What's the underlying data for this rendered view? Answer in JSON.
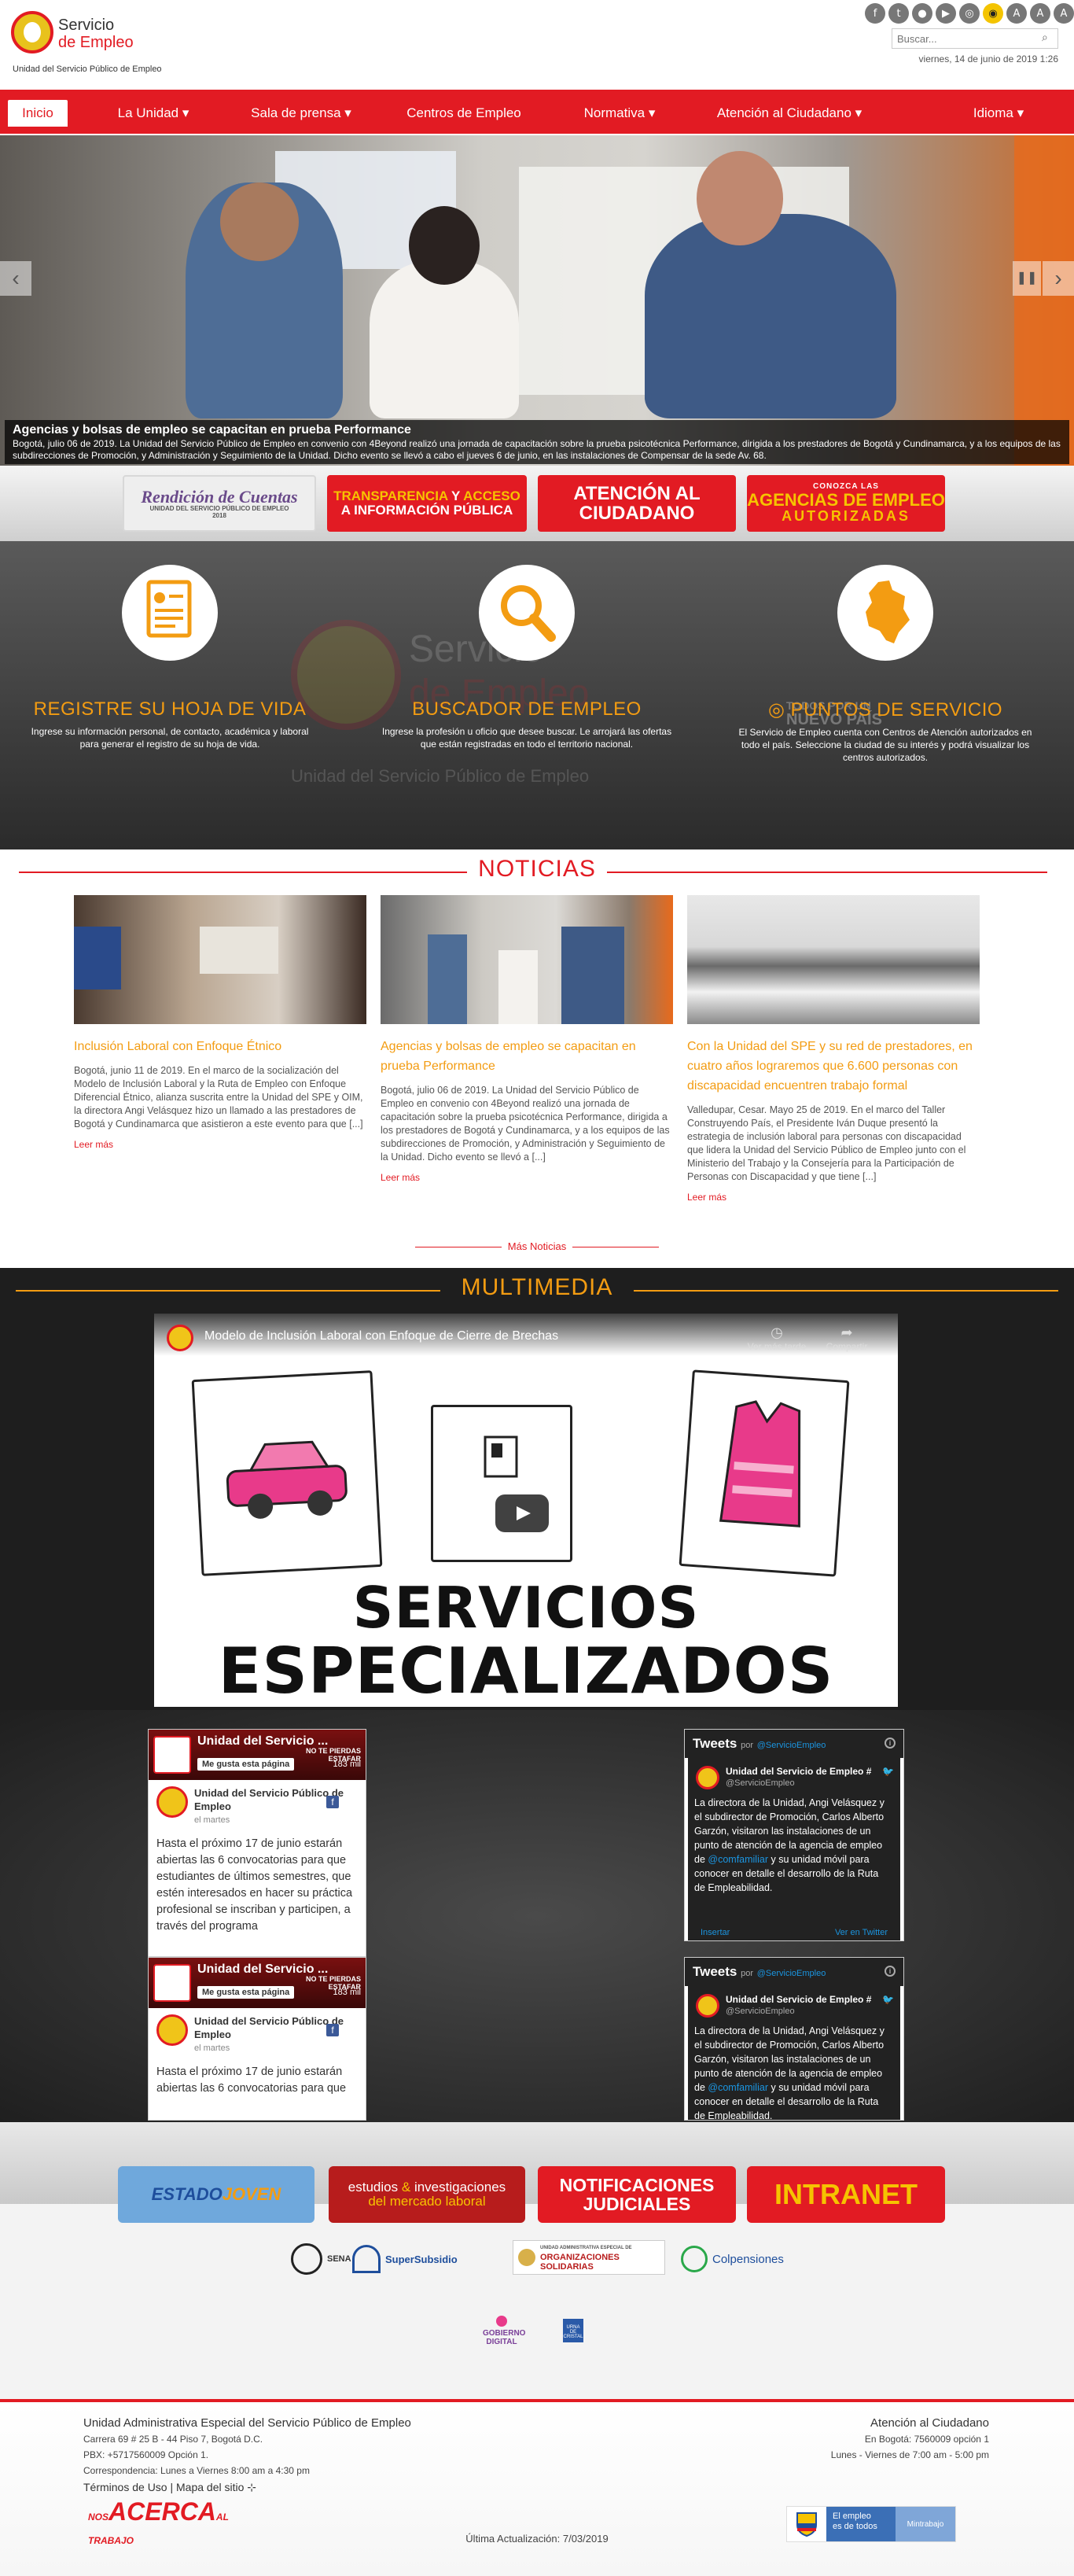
{
  "header": {
    "logo_line1": "Servicio",
    "logo_line2": "de Empleo",
    "logo_sub": "Unidad del Servicio Público de Empleo",
    "social_icons": [
      "facebook-icon",
      "twitter-icon",
      "flickr-icon",
      "youtube-icon",
      "instagram-icon",
      "visibility-icon",
      "font-size-icon",
      "font-size-larger-icon",
      "font-size-largest-icon"
    ],
    "search_placeholder": "Buscar...",
    "date": "viernes, 14 de junio de 2019 1:26"
  },
  "nav": {
    "items": [
      "Inicio",
      "La Unidad",
      "Sala de prensa",
      "Centros de Empleo",
      "Normativa",
      "Atención al Ciudadano",
      "Idioma"
    ],
    "active": "Inicio",
    "accent": "#e21b23"
  },
  "hero": {
    "title": "Agencias y bolsas de empleo se capacitan en prueba Performance",
    "text": "Bogotá, julio 06 de 2019. La Unidad del Servicio Público de Empleo en convenio con 4Beyond realizó una jornada de capacitación sobre la prueba psicotécnica Performance, dirigida a los prestadores de Bogotá y Cundinamarca, y a los equipos de las subdirecciones de Promoción, y Administración y Seguimiento de la Unidad. Dicho evento se llevó a cabo el jueves 6 de junio, en las instalaciones de Compensar de la sede Av. 68."
  },
  "banners": {
    "rendicion": "Rendición de Cuentas",
    "rendicion_sub": "UNIDAD DEL SERVICIO PÚBLICO DE EMPLEO",
    "rendicion_year": "2018",
    "transparencia_a": "TRANSPARENCIA",
    "transparencia_y": "Y",
    "transparencia_b": "ACCESO",
    "transparencia_c": "A INFORMACIÓN PÚBLICA",
    "atencion_a": "ATENCIÓN AL",
    "atencion_b": "CIUDADANO",
    "agencias_pre": "CONOZCA LAS",
    "agencias_a": "AGENCIAS DE EMPLEO",
    "agencias_b": "AUTORIZADAS"
  },
  "services": [
    {
      "title": "REGISTRE SU HOJA DE VIDA",
      "text": "Ingrese su información personal, de contacto, académica y laboral para generar el registro de su hoja de vida.",
      "icon": "resume-document-icon"
    },
    {
      "title": "BUSCADOR DE EMPLEO",
      "text": "Ingrese la profesión u oficio que desee buscar. Le arrojará las ofertas que están registradas en todo el territorio nacional.",
      "icon": "magnifier-search-icon"
    },
    {
      "title": "PUNTOS DE SERVICIO",
      "text": "El Servicio de Empleo cuenta con Centros de Atención autorizados en todo el país. Seleccione la ciudad de su interés y podrá visualizar los centros autorizados.",
      "icon": "colombia-map-icon"
    }
  ],
  "services_watermark": {
    "logo_a": "Servicio",
    "logo_b": "de Empleo",
    "caption": "Unidad del Servicio Público de Empleo",
    "slogan_a": "TODOS POR UN",
    "slogan_b": "NUEVO PAÍS"
  },
  "noticias": {
    "title": "NOTICIAS",
    "items": [
      {
        "title": "Inclusión Laboral con Enfoque Étnico",
        "text": "Bogotá, junio 11 de 2019. En el marco de la socialización del Modelo de Inclusión Laboral y la Ruta de Empleo con Enfoque Diferencial Étnico, alianza suscrita entre la Unidad del SPE y OIM, la directora Angi Velásquez hizo un llamado a las prestadores de Bogotá y Cundinamarca que asistieron a este evento para que [...]",
        "more": "Leer más"
      },
      {
        "title": "Agencias y bolsas de empleo se capacitan en prueba Performance",
        "text": "Bogotá, julio 06 de 2019. La Unidad del Servicio Público de Empleo en convenio con 4Beyond realizó una jornada de capacitación sobre la prueba psicotécnica Performance, dirigida a los prestadores de Bogotá y Cundinamarca, y a los equipos de las subdirecciones de Promoción, y Administración y Seguimiento de la Unidad. Dicho evento se llevó a [...]",
        "more": "Leer más"
      },
      {
        "title": "Con la Unidad del SPE y su red de prestadores, en cuatro años lograremos que 6.600 personas con discapacidad encuentren trabajo formal",
        "text": "Valledupar, Cesar. Mayo 25 de 2019. En el marco del Taller Construyendo País, el Presidente Iván Duque presentó la estrategia de inclusión laboral para personas con discapacidad que lidera la Unidad del Servicio Público de Empleo junto con el Ministerio del Trabajo y la Consejería para la Participación de Personas con Discapacidad y que tiene [...]",
        "more": "Leer más"
      }
    ],
    "more_link": "Más Noticias"
  },
  "multimedia": {
    "title": "MULTIMEDIA",
    "video_title": "Modelo de Inclusión Laboral con Enfoque de Cierre de Brechas",
    "watch_later": "Ver más tarde",
    "share": "Compartir",
    "line1": "SERVICIOS",
    "line2": "ESPECIALIZADOS"
  },
  "facebook": {
    "page_name": "Unidad del Servicio ...",
    "like": "Me gusta esta página",
    "count": "183 mil",
    "badge_a": "NO TE PIERDAS",
    "badge_b": "ESTAFAR",
    "post_name": "Unidad del Servicio Público de Empleo",
    "post_date": "el martes",
    "post_text_long": "Hasta el próximo 17 de junio estarán abiertas las 6 convocatorias para que estudiantes de últimos semestres, que estén interesados en hacer su práctica profesional se inscriban y participen, a través del programa",
    "post_text_short": "Hasta el próximo 17 de junio estarán abiertas las 6 convocatorias para que"
  },
  "twitter": {
    "title": "Tweets",
    "by": "por",
    "handle": "@ServicioEmpleo",
    "author": "Unidad del Servicio de Empleo #",
    "text_a": "La directora de la Unidad, Angi Velásquez y el subdirector de Promoción, Carlos Alberto Garzón, visitaron las instalaciones de un punto de atención de la agencia de empleo de",
    "mention": "@comfamiliar",
    "text_b": "y su unidad móvil para conocer en detalle el desarrollo de la Ruta de Empleabilidad.",
    "insert": "Insertar",
    "view": "Ver en Twitter"
  },
  "lower_banners": {
    "estado": "ESTADO",
    "joven": "JOVEN",
    "estudios_a": "estudios",
    "estudios_amp": "&",
    "estudios_b": "investigaciones",
    "estudios_c": "del mercado laboral",
    "notif_a": "NOTIFICACIONES",
    "notif_b": "JUDICIALES",
    "intra_a": "INTRA",
    "intra_b": "NET"
  },
  "partners": {
    "sena": "SENA",
    "supersubsidio": "SuperSubsidio",
    "org_pre": "UNIDAD ADMINISTRATIVA ESPECIAL DE",
    "org_a": "ORGANIZACIONES",
    "org_b": "SOLIDARIAS",
    "colpensiones": "Colpensiones",
    "gobierno_a": "GOBIERNO",
    "gobierno_b": "DIGITAL",
    "urna": "URNA DE CRISTAL"
  },
  "footer": {
    "title": "Unidad Administrativa Especial del Servicio Público de Empleo",
    "address": "Carrera 69 # 25 B - 44 Piso 7, Bogotá D.C.",
    "pbx": "PBX: +5717560009 Opción 1.",
    "correspondencia": "Correspondencia: Lunes a Viernes 8:00 am a 4:30 pm",
    "terms": "Términos de Uso | Mapa del sitio",
    "acerca_pre": "NOS",
    "acerca": "ACERCA",
    "acerca_al": "AL",
    "acerca_sub": "TRABAJO",
    "update": "Última Actualización: 7/03/2019",
    "right_title": "Atención al Ciudadano",
    "right_phone": "En Bogotá: 7560009 opción 1",
    "right_hours": "Lunes - Viernes de 7:00 am - 5:00 pm",
    "gov_a": "El empleo",
    "gov_b": "es de todos",
    "gov_c": "Mintrabajo"
  }
}
